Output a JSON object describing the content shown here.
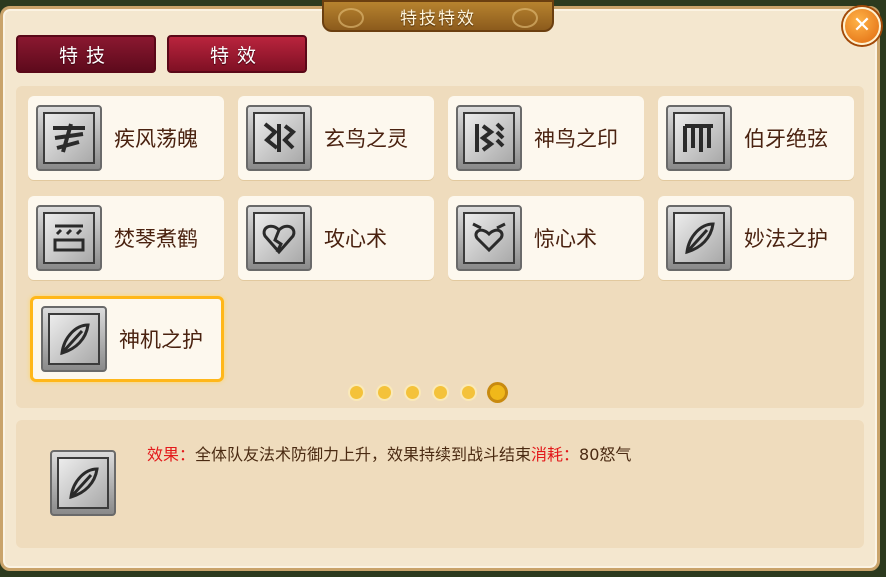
{
  "window": {
    "title": "特技特效",
    "close_symbol": "✕"
  },
  "tabs": [
    {
      "label": "特技",
      "active": true
    },
    {
      "label": "特效",
      "active": false
    }
  ],
  "skills": [
    {
      "label": "疾风荡魄",
      "icon": "wind-glyph-icon"
    },
    {
      "label": "玄鸟之灵",
      "icon": "bird-glyph-icon"
    },
    {
      "label": "神鸟之印",
      "icon": "feather-glyph-icon"
    },
    {
      "label": "伯牙绝弦",
      "icon": "harp-glyph-icon"
    },
    {
      "label": "焚琴煮鹤",
      "icon": "zither-glyph-icon"
    },
    {
      "label": "攻心术",
      "icon": "heart-break-icon"
    },
    {
      "label": "惊心术",
      "icon": "heart-glyph-icon"
    },
    {
      "label": "妙法之护",
      "icon": "leaf-feather-icon"
    },
    {
      "label": "神机之护",
      "icon": "leaf-feather-icon",
      "selected": true
    }
  ],
  "pagination": {
    "total": 6,
    "active": 6
  },
  "detail": {
    "icon": "leaf-feather-icon",
    "effect_label": "效果：",
    "effect_text": "全体队友法术防御力上升，效果持续到战斗结束",
    "cost_label": "消耗：",
    "cost_text": "80怒气"
  },
  "colors": {
    "accent_red": "#e3191b",
    "tab_red": "#9c1a30",
    "highlight": "#ffb71a"
  }
}
